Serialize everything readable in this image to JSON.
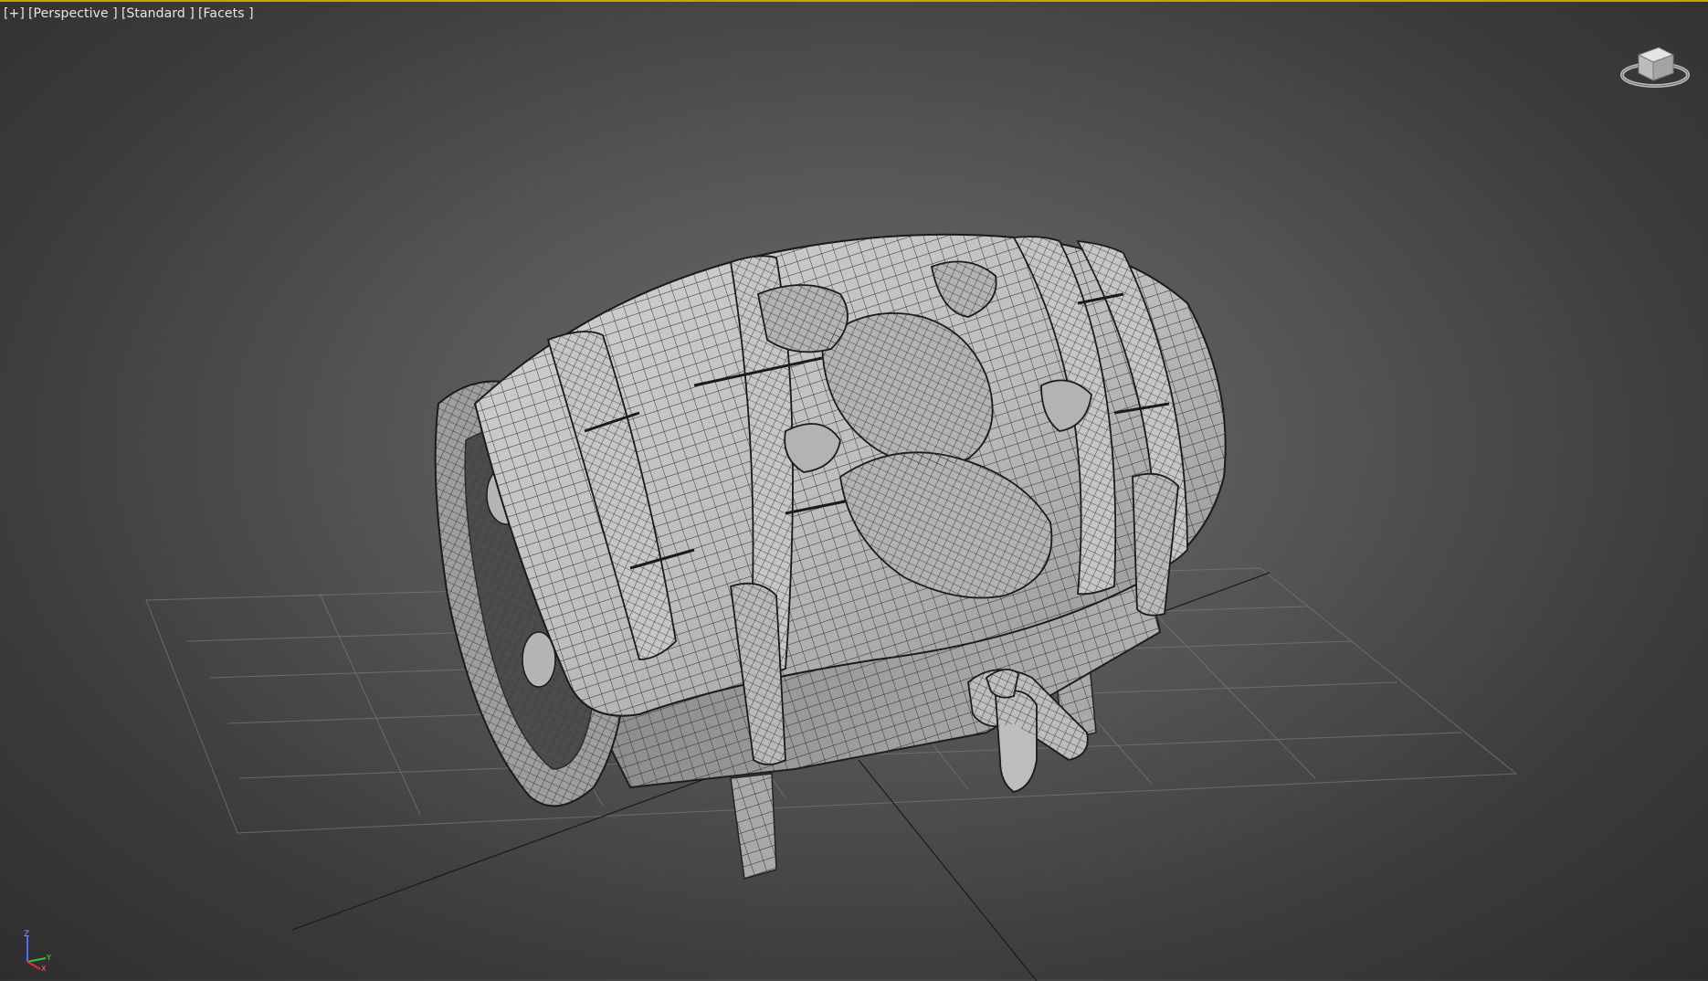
{
  "app": "3ds Max viewport",
  "viewport": {
    "labels": [
      "[+]",
      "[Perspective ]",
      "[Standard ]",
      "[Facets ]"
    ]
  },
  "axis_tripod": {
    "z": "Z",
    "x": "X",
    "y": "Y"
  },
  "colors": {
    "active_viewport_border": "#c9a200",
    "background_center": "#6a6a6a",
    "background_edge": "#2e2e2e",
    "grid_line": "#7a7a7a",
    "mesh_fill": "#b8b8b8",
    "mesh_wire": "#2a2a2a"
  },
  "icons": {
    "viewcube": "viewcube-icon",
    "tripod": "axis-tripod-icon"
  }
}
